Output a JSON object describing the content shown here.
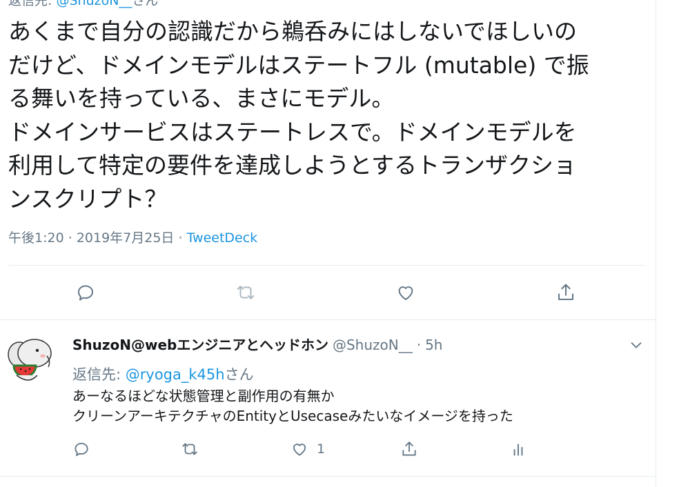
{
  "main_tweet": {
    "reply_label": "返信先:",
    "reply_handle": "@ShuzoN__",
    "reply_suffix": "さん",
    "text": "あくまで自分の認識だから鵜呑みにはしないでほしいの\nだけど、ドメインモデルはステートフル (mutable) で振\nる舞いを持っている、まさにモデル。\nドメインサービスはステートレスで。ドメインモデルを\n利用して特定の要件を達成しようとするトランザクショ\nンスクリプト？",
    "time": "午後1:20",
    "date": "2019年7月25日",
    "source": "TweetDeck",
    "actions": [
      "reply-icon",
      "retweet-icon",
      "like-icon",
      "share-icon"
    ]
  },
  "reply_tweet": {
    "display_name": "ShuzoN@webエンジニアとヘッドホン",
    "handle": "@ShuzoN__",
    "dot": "·",
    "time": "5h",
    "reply_label": "返信先:",
    "reply_handle": "@ryoga_k45h",
    "reply_suffix": "さん",
    "text": "あーなるほどな状態管理と副作用の有無か\nクリーンアーキテクチャのEntityとUsecaseみたいなイメージを持った",
    "like_count": "1",
    "actions": [
      "reply-icon",
      "retweet-icon",
      "like-icon",
      "share-icon",
      "analytics-icon"
    ]
  },
  "colors": {
    "accent": "#1b95e0",
    "muted": "#657786",
    "retweet_disabled": "#aab8c2",
    "divider": "#e6ecf0"
  }
}
